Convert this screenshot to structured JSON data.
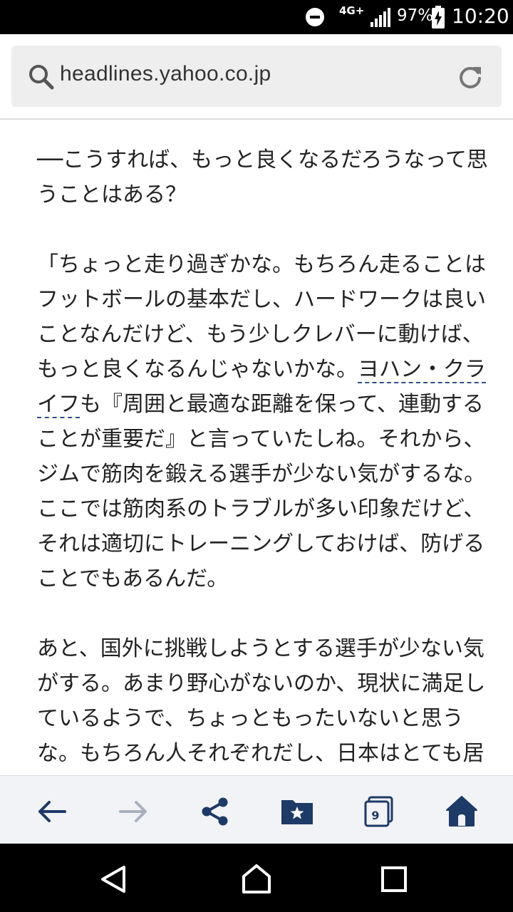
{
  "status_bar": {
    "network": "4G+",
    "battery_percent": "97%",
    "time": "10:20",
    "icons": [
      "do-not-disturb-icon",
      "signal-icon",
      "battery-charging-icon"
    ]
  },
  "address_bar": {
    "url": "headlines.yahoo.co.jp",
    "icons": [
      "search-icon",
      "reload-icon"
    ]
  },
  "article": {
    "p1": "──こうすれば、もっと良くなるだろうなって思うことはある？",
    "p2_before": "「ちょっと走り過ぎかな。もちろん走ることはフットボールの基本だし、ハードワークは良いことなんだけど、もう少しクレバーに動けば、もっと良くなるんじゃないかな。",
    "p2_link": "ヨハン・クライフ",
    "p2_after": "も『周囲と最適な距離を保って、連動することが重要だ』と言っていたしね。それから、ジムで筋肉を鍛える選手が少ない気がするな。ここでは筋肉系のトラブルが多い印象だけど、それは適切にトレーニングしておけば、防げることでもあるんだ。",
    "p3": "あと、国外に挑戦しようとする選手が少ない気がする。あまり野心がないのか、現状に満足しているようで、ちょっともったいないと思うな。もちろん人それぞれだし、日本はとても居心地の良い国だから、どちらが正しいとは言わ"
  },
  "toolbar": {
    "tabs_count": "9",
    "icons": [
      "back-arrow-icon",
      "forward-arrow-icon",
      "share-icon",
      "bookmark-folder-icon",
      "tabs-icon",
      "home-icon"
    ]
  },
  "nav_bar": {
    "icons": [
      "nav-back-icon",
      "nav-home-icon",
      "nav-recents-icon"
    ]
  },
  "colors": {
    "toolbar_icon": "#1e3a66",
    "toolbar_icon_disabled": "#a9b0bd",
    "link_underline": "#2c4f8a",
    "address_bg": "#eeeeee"
  }
}
